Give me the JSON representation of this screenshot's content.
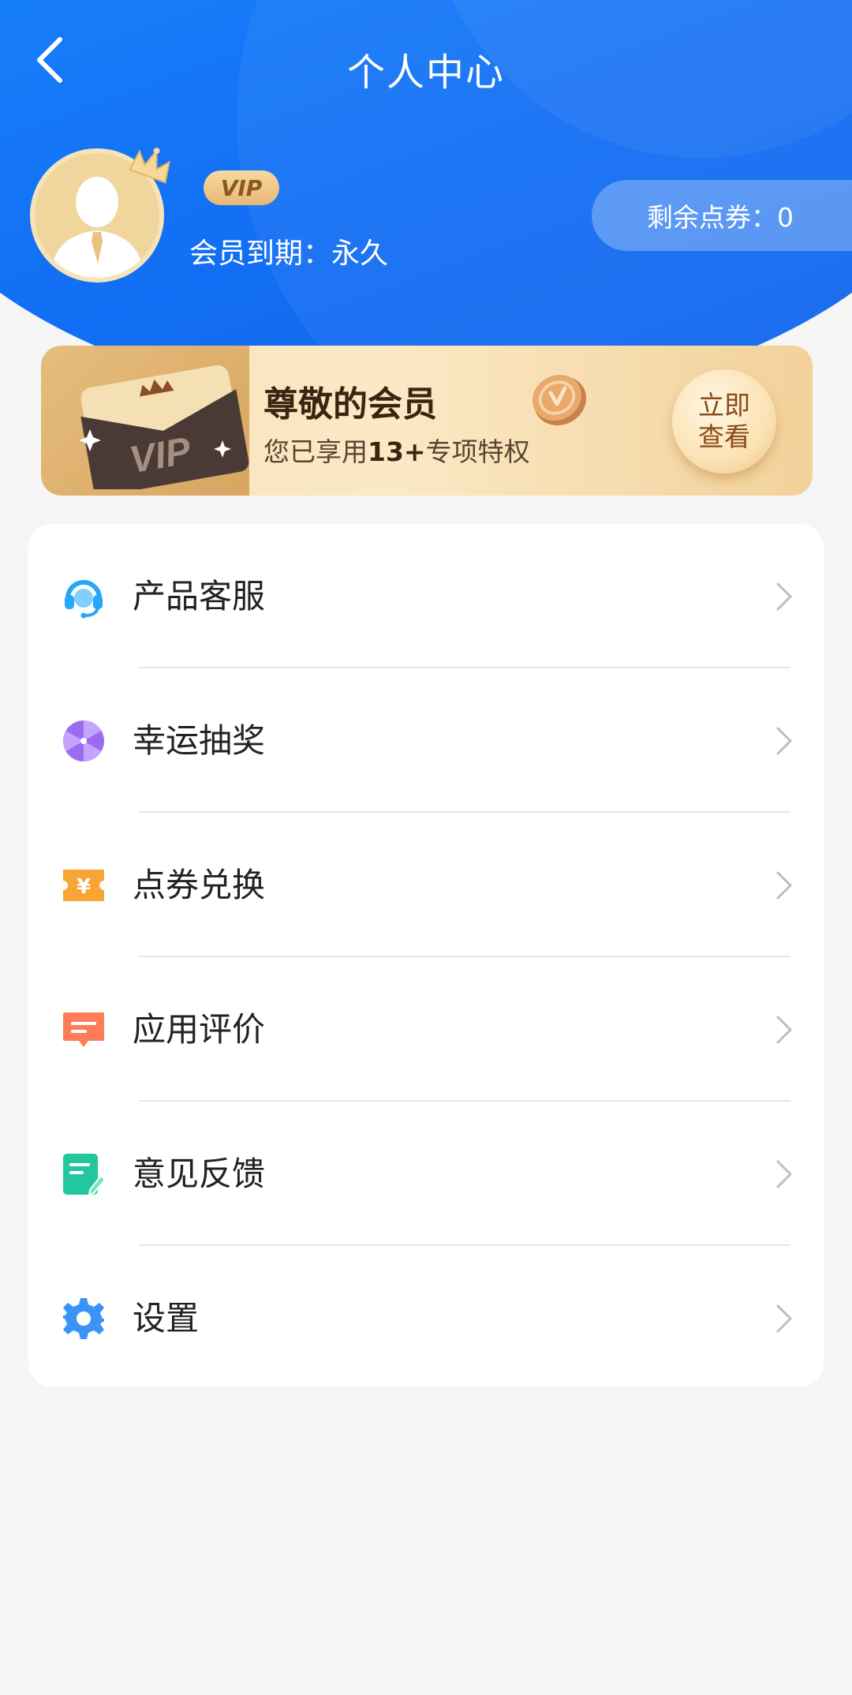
{
  "header": {
    "title": "个人中心",
    "back_icon": "chevron-left-icon",
    "background_color": "#1370f5"
  },
  "profile": {
    "avatar_icon": "user-avatar-icon",
    "crown_icon": "crown-icon",
    "vip_badge": "VIP",
    "member_expiry": "会员到期：永久",
    "points_text": "剩余点券：0"
  },
  "vip_banner": {
    "card_label": "VIP",
    "title": "尊敬的会员",
    "subtitle_prefix": "您已享用",
    "subtitle_highlight": "13+",
    "subtitle_suffix": "专项特权",
    "button_line1": "立即",
    "button_line2": "查看"
  },
  "menu": {
    "items": [
      {
        "label": "产品客服",
        "icon": "headset-icon",
        "color": "#29a6f5"
      },
      {
        "label": "幸运抽奖",
        "icon": "lucky-wheel-icon",
        "color": "#9b6cf0"
      },
      {
        "label": "点券兑换",
        "icon": "yuan-coupon-icon",
        "color": "#f7a534",
        "glyph": "¥"
      },
      {
        "label": "应用评价",
        "icon": "comment-icon",
        "color": "#ff7d56"
      },
      {
        "label": "意见反馈",
        "icon": "feedback-edit-icon",
        "color": "#22c7a0"
      },
      {
        "label": "设置",
        "icon": "gear-icon",
        "color": "#3a94f5"
      }
    ],
    "chevron_icon": "chevron-right-icon"
  }
}
